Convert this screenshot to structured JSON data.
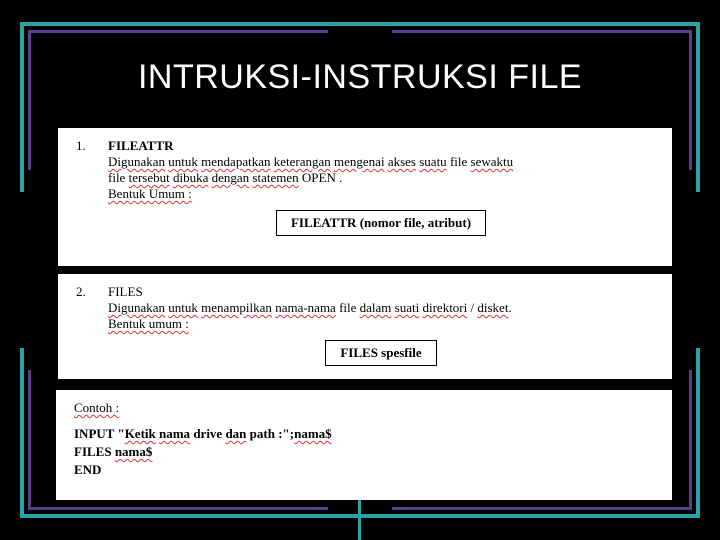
{
  "title": "INTRUKSI-INSTRUKSI FILE",
  "item1": {
    "num": "1.",
    "name": "FILEATTR",
    "desc_a": "Digunakan",
    "desc_b": "untuk",
    "desc_c": "mendapatkan",
    "desc_d": "keterangan",
    "desc_e": "mengenai",
    "desc_f": "akses",
    "desc_g": "suatu",
    "desc_h": "file",
    "desc_i": "sewaktu",
    "desc2_a": "file",
    "desc2_b": "tersebut",
    "desc2_c": "dibuka",
    "desc2_d": "dengan",
    "desc2_e": "statemen",
    "desc2_f": "OPEN .",
    "form_label": "Bentuk Umum :",
    "syntax": "FILEATTR (nomor file, atribut)"
  },
  "item2": {
    "num": "2.",
    "name": "FILES",
    "desc_a": "Digunakan",
    "desc_b": "untuk",
    "desc_c": "menampilkan",
    "desc_d": "nama-nama",
    "desc_e": "file",
    "desc_f": "dalam",
    "desc_g": "suati",
    "desc_h": "direktori",
    "slash": "/",
    "desc_i": "disket",
    "dot": ".",
    "form_label": "Bentuk umum :",
    "syntax": "FILES spesfile"
  },
  "example": {
    "label": "Contoh :",
    "l1_a": "INPUT \"",
    "l1_b": "Ketik",
    "l1_c": "nama",
    "l1_d": "drive",
    "l1_e": "dan",
    "l1_f": "path :\";",
    "l1_g": "nama$",
    "l2_a": "FILES",
    "l2_b": "nama$",
    "l3": "END"
  }
}
